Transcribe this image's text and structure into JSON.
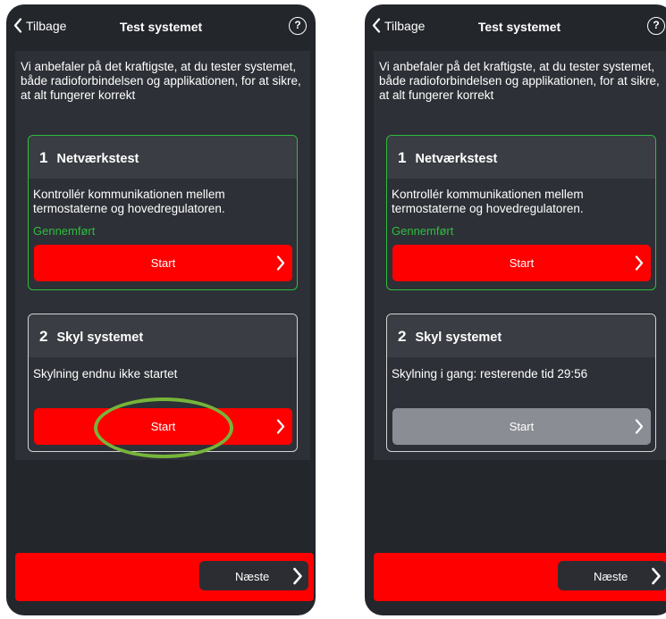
{
  "screens": [
    {
      "nav": {
        "back_label": "Tilbage",
        "title": "Test systemet",
        "help_label": "?"
      },
      "intro": "Vi anbefaler på det kraftigste, at du tester systemet, både radioforbindelsen og applikationen, for at sikre, at alt fungerer korrekt",
      "network_test": {
        "number": "1",
        "title": "Netværkstest",
        "description": "Kontrollér kommunikationen mellem termostaterne og hovedregulatoren.",
        "status": "Gennemført",
        "start_label": "Start"
      },
      "flush_system": {
        "number": "2",
        "title": "Skyl systemet",
        "description": "Skylning endnu ikke startet",
        "start_label": "Start",
        "start_enabled": true
      },
      "footer": {
        "next_label": "Næste"
      }
    },
    {
      "nav": {
        "back_label": "Tilbage",
        "title": "Test systemet",
        "help_label": "?"
      },
      "intro": "Vi anbefaler på det kraftigste, at du tester systemet, både radioforbindelsen og applikationen, for at sikre, at alt fungerer korrekt",
      "network_test": {
        "number": "1",
        "title": "Netværkstest",
        "description": "Kontrollér kommunikationen mellem termostaterne og hovedregulatoren.",
        "status": "Gennemført",
        "start_label": "Start"
      },
      "flush_system": {
        "number": "2",
        "title": "Skyl systemet",
        "description": "Skylning i gang: resterende tid 29:56",
        "start_label": "Start",
        "start_enabled": false
      },
      "footer": {
        "next_label": "Næste"
      }
    }
  ],
  "colors": {
    "background": "#23262b",
    "panel": "#2d3036",
    "card_header": "#3a3d43",
    "accent_red": "#ff0000",
    "success_green": "#2ebd3f",
    "disabled_gray": "#8a8d93",
    "highlight_ring": "#76b43a"
  }
}
